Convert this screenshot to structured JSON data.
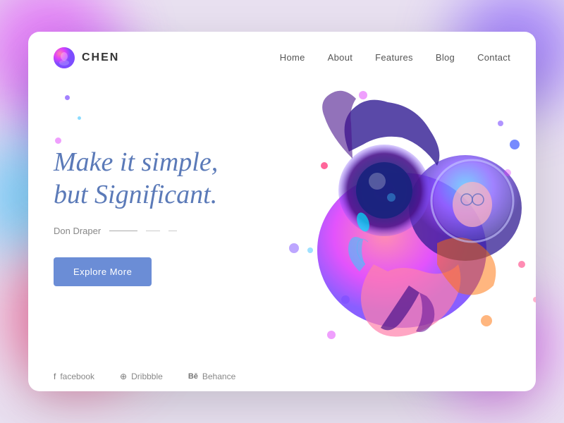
{
  "background": {
    "color": "#e8e0f0"
  },
  "card": {
    "background": "#ffffff"
  },
  "logo": {
    "text": "CHEN",
    "icon": "face-icon"
  },
  "nav": {
    "items": [
      {
        "label": "Home",
        "href": "#"
      },
      {
        "label": "About",
        "href": "#"
      },
      {
        "label": "Features",
        "href": "#"
      },
      {
        "label": "Blog",
        "href": "#"
      },
      {
        "label": "Contact",
        "href": "#"
      }
    ]
  },
  "hero": {
    "headline_line1": "Make it simple,",
    "headline_line2": "but Significant.",
    "author": "Don Draper",
    "cta_label": "Explore More"
  },
  "footer": {
    "links": [
      {
        "icon": "f",
        "label": "facebook"
      },
      {
        "icon": "⊕",
        "label": "Dribbble"
      },
      {
        "icon": "Bē",
        "label": "Behance"
      }
    ]
  },
  "colors": {
    "headline": "#5b7ab8",
    "cta_bg": "#6b8dd6",
    "accent_pink": "#e040fb",
    "accent_purple": "#7c4dff",
    "accent_blue": "#40c4ff"
  }
}
